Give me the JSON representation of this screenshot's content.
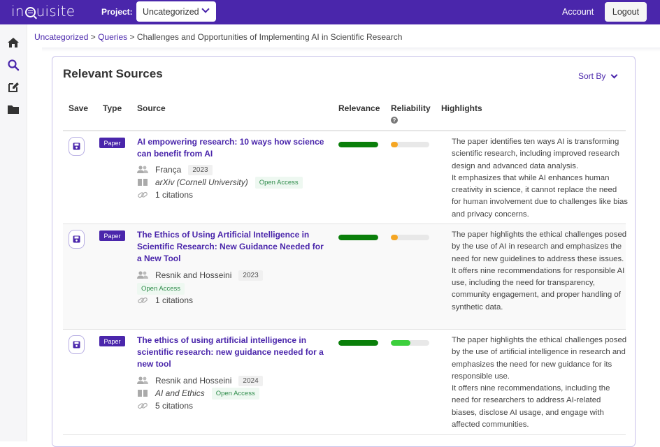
{
  "app": {
    "logo": "inquisite",
    "project_label": "Project:",
    "project_value": "Uncategorized",
    "account_label": "Account",
    "logout_label": "Logout"
  },
  "sidebar": {
    "items": [
      {
        "name": "home",
        "icon": "home-icon"
      },
      {
        "name": "search",
        "icon": "search-icon",
        "active": true
      },
      {
        "name": "edit",
        "icon": "edit-icon"
      },
      {
        "name": "folder",
        "icon": "folder-icon"
      }
    ]
  },
  "breadcrumb": {
    "items": [
      "Uncategorized",
      "Queries"
    ],
    "separator": ">",
    "current": "Challenges and Opportunities of Implementing AI in Scientific Research"
  },
  "card": {
    "title": "Relevant Sources",
    "sort_label": "Sort By",
    "columns": [
      "Save",
      "Type",
      "Source",
      "Relevance",
      "Reliability",
      "Highlights"
    ],
    "reliability_help": "?"
  },
  "colors": {
    "brand": "#4a26ab",
    "relevance_high": "#0a7f0a",
    "reliability_low": "#f5a623",
    "reliability_mid": "#3ccf3c",
    "open_access": "#2e8b4a"
  },
  "rows": [
    {
      "type": "Paper",
      "title": "AI empowering research: 10 ways how science can benefit from AI",
      "authors": "França",
      "year": "2023",
      "journal": "arXiv (Cornell University)",
      "access": "Open Access",
      "citations": "1 citations",
      "relevance": 1.0,
      "reliability": 0.18,
      "reliability_color": "#f5a623",
      "highlights": "The paper identifies ten ways AI is transforming scientific research, including improved research design and advanced data analysis.\nIt emphasizes that while AI enhances human creativity in science, it cannot replace the need for human involvement due to challenges like bias and privacy concerns."
    },
    {
      "type": "Paper",
      "title": "The Ethics of Using Artificial Intelligence in Scientific Research: New Guidance Needed for a New Tool",
      "authors": "Resnik and Hosseini",
      "year": "2023",
      "journal": "",
      "access": "Open Access",
      "citations": "1 citations",
      "relevance": 1.0,
      "reliability": 0.18,
      "reliability_color": "#f5a623",
      "highlights": "The paper highlights the ethical challenges posed by the use of AI in research and emphasizes the need for new guidelines to address these issues.\nIt offers nine recommendations for responsible AI use, including the need for transparency, community engagement, and proper handling of synthetic data."
    },
    {
      "type": "Paper",
      "title": "The ethics of using artificial intelligence in scientific research: new guidance needed for a new tool",
      "authors": "Resnik and Hosseini",
      "year": "2024",
      "journal": "AI and Ethics",
      "access": "Open Access",
      "citations": "5 citations",
      "relevance": 1.0,
      "reliability": 0.5,
      "reliability_color": "#3ccf3c",
      "highlights": "The paper highlights the ethical challenges posed by the use of artificial intelligence in research and emphasizes the need for new guidance for its responsible use.\nIt offers nine recommendations, including the need for researchers to address AI-related biases, disclose AI usage, and engage with affected communities."
    }
  ]
}
